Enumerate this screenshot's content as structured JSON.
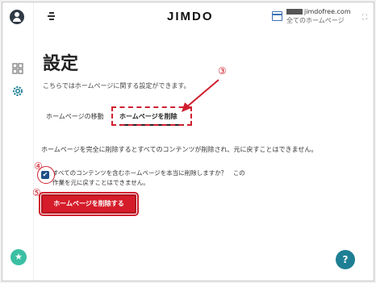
{
  "app": {
    "logo": "JIMDO"
  },
  "site": {
    "url": "jimdofree.com",
    "subtitle": "全てのホームページ"
  },
  "page": {
    "title": "設定",
    "description": "こちらではホームページに関する設定ができます。"
  },
  "tabs": [
    {
      "label": "ホームページの移動",
      "active": false
    },
    {
      "label": "ホームページを削除",
      "active": true
    }
  ],
  "delete": {
    "warning": "ホームページを完全に削除するとすべてのコンテンツが削除され、元に戻すことはできません。",
    "confirm_text": "すべてのコンテンツを含むホームページを本当に削除しますか？　この作業を元に戻すことはできません。",
    "confirm_checked": true,
    "button_label": "ホームページを削除する"
  },
  "help": {
    "label": "?"
  },
  "annotations": {
    "marker_3": "③",
    "marker_4": "④",
    "marker_5": "⑤"
  },
  "icons": {
    "rail": [
      "user-avatar-icon",
      "dashboard-grid-icon",
      "settings-gear-icon",
      "star-icon"
    ],
    "top": [
      "menu-icon",
      "site-window-icon",
      "expand-icon"
    ]
  },
  "colors": {
    "accent_red": "#d51c2a",
    "help_teal": "#1e7f94",
    "star_green": "#3bbfa3",
    "checkbox_blue": "#1f4f86"
  }
}
